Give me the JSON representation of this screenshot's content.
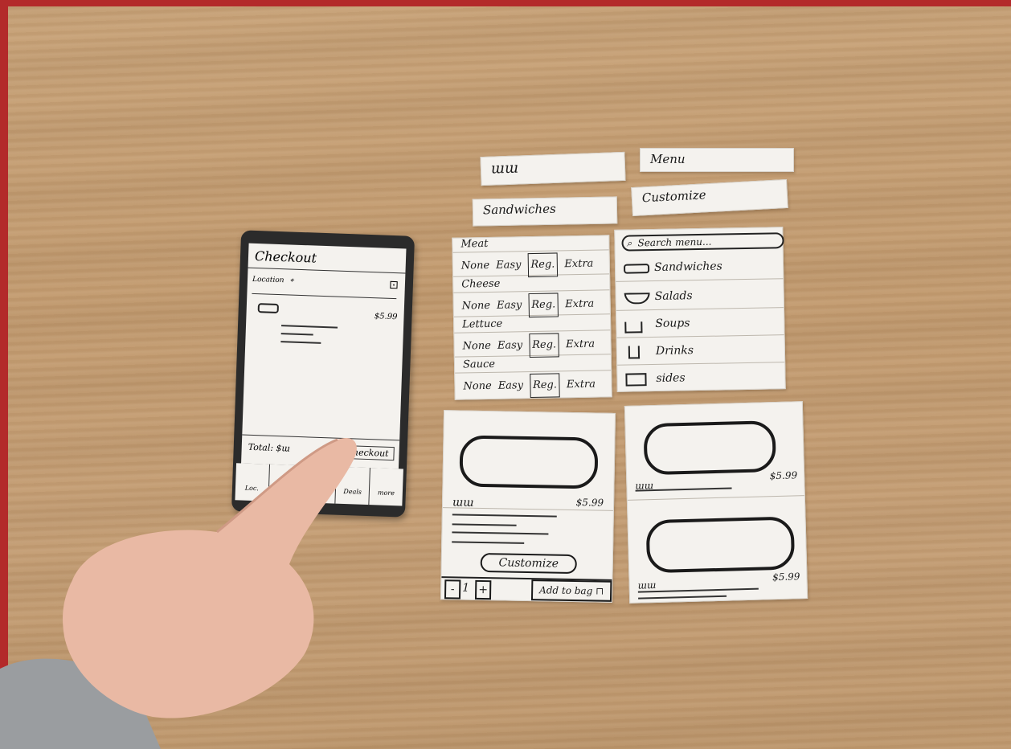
{
  "strips": {
    "scribble": "ɯɯ",
    "menu": "Menu",
    "sandwiches": "Sandwiches",
    "customize": "Customize"
  },
  "phone": {
    "title": "Checkout",
    "location_label": "Location",
    "item_price": "$5.99",
    "total_label": "Total: $ɯ",
    "checkout_button": "Checkout",
    "nav": [
      "Loc.",
      "",
      "",
      "Deals",
      "more"
    ]
  },
  "customize_card": {
    "sections": [
      {
        "name": "Meat",
        "options": [
          "None",
          "Easy",
          "Reg.",
          "Extra"
        ],
        "selected": "Reg."
      },
      {
        "name": "Cheese",
        "options": [
          "None",
          "Easy",
          "Reg.",
          "Extra"
        ],
        "selected": "Reg."
      },
      {
        "name": "Lettuce",
        "options": [
          "None",
          "Easy",
          "Reg.",
          "Extra"
        ],
        "selected": "Reg."
      },
      {
        "name": "Sauce",
        "options": [
          "None",
          "Easy",
          "Reg.",
          "Extra"
        ],
        "selected": "Reg."
      }
    ]
  },
  "menu_card": {
    "search_placeholder": "Search menu...",
    "items": [
      {
        "label": "Sandwiches",
        "icon": "sandwich-icon"
      },
      {
        "label": "Salads",
        "icon": "salad-bowl-icon"
      },
      {
        "label": "Soups",
        "icon": "soup-cup-icon"
      },
      {
        "label": "Drinks",
        "icon": "drink-cup-icon"
      },
      {
        "label": "sides",
        "icon": "sides-icon"
      }
    ]
  },
  "detail_card": {
    "price": "$5.99",
    "customize_button": "Customize",
    "qty_minus": "-",
    "qty_value": "1",
    "qty_plus": "+",
    "add_to_bag": "Add to bag"
  },
  "list_card": {
    "items": [
      {
        "price": "$5.99"
      },
      {
        "price": "$5.99"
      }
    ]
  },
  "colors": {
    "wood": "#c6a077",
    "paper": "#f4f2ee",
    "border": "#b32a2a",
    "ink": "#1a1a1a"
  }
}
